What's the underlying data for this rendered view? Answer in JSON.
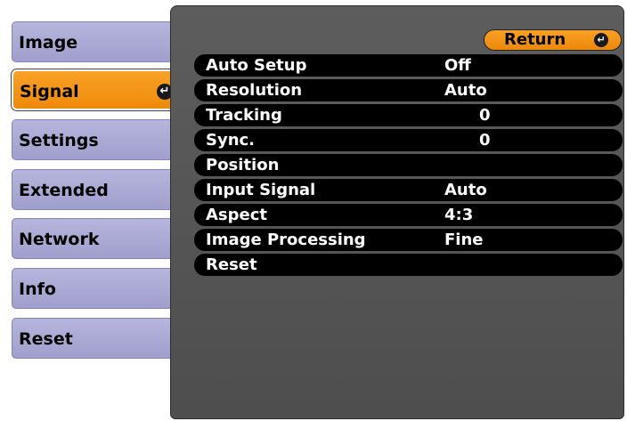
{
  "tabs": [
    {
      "label": "Image"
    },
    {
      "label": "Signal",
      "active": true
    },
    {
      "label": "Settings"
    },
    {
      "label": "Extended"
    },
    {
      "label": "Network"
    },
    {
      "label": "Info"
    },
    {
      "label": "Reset"
    }
  ],
  "enter_icon": "enter-icon",
  "return_button": {
    "label": "Return"
  },
  "items": [
    {
      "label": "Auto Setup",
      "value": "Off"
    },
    {
      "label": "Resolution",
      "value": "Auto"
    },
    {
      "label": "Tracking",
      "value": "0"
    },
    {
      "label": "Sync.",
      "value": "0"
    },
    {
      "label": "Position",
      "value": ""
    },
    {
      "label": "Input Signal",
      "value": "Auto"
    },
    {
      "label": "Aspect",
      "value": "4:3"
    },
    {
      "label": "Image Processing",
      "value": "Fine"
    },
    {
      "label": "Reset",
      "value": ""
    }
  ],
  "colors": {
    "accent": "#f39416",
    "tab_bg": "#aaa9d3",
    "panel_bg": "#555555",
    "item_bg": "#000000"
  }
}
